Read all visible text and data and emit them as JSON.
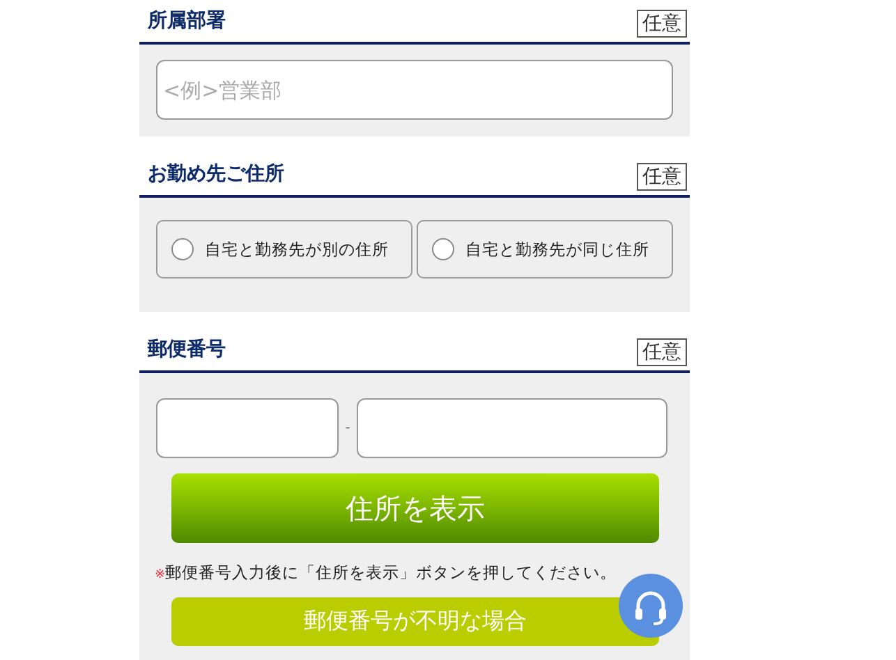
{
  "sections": [
    {
      "kind": "text",
      "title": "所属部署",
      "badge": "任意",
      "placeholder": "<例>営業部"
    },
    {
      "kind": "radio",
      "title": "お勤め先ご住所",
      "badge": "任意",
      "options": [
        {
          "label": "自宅と勤務先が別の住所",
          "selected": false
        },
        {
          "label": "自宅と勤務先が同じ住所",
          "selected": false
        }
      ]
    },
    {
      "kind": "zip",
      "title": "郵便番号",
      "badge": "任意",
      "separator": "-",
      "button": "住所を表示",
      "note_mark": "※",
      "note": "郵便番号入力後に「住所を表示」ボタンを押してください。",
      "secondary_button": "郵便番号が不明な場合"
    }
  ]
}
